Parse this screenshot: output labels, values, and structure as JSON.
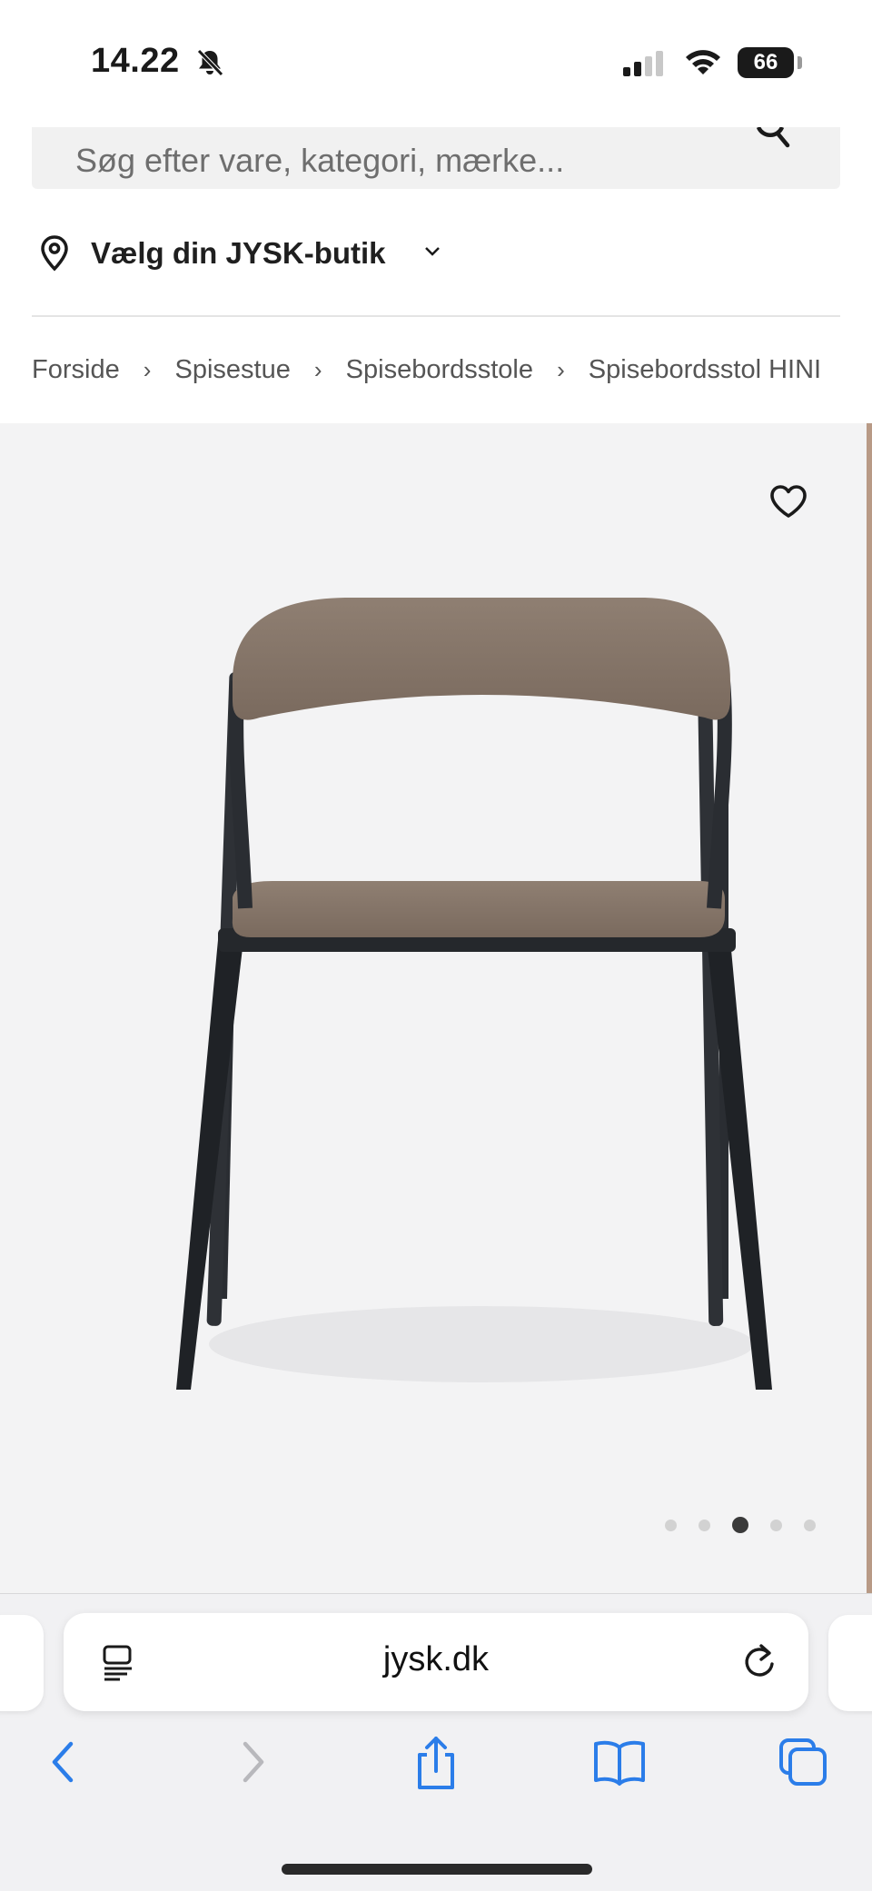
{
  "status": {
    "time": "14.22",
    "battery": "66"
  },
  "search": {
    "placeholder": "Søg efter vare, kategori, mærke..."
  },
  "store": {
    "label": "Vælg din JYSK-butik"
  },
  "breadcrumb": [
    {
      "label": "Forside"
    },
    {
      "label": "Spisestue"
    },
    {
      "label": "Spisebordsstole"
    },
    {
      "label": "Spisebordsstol HINI"
    }
  ],
  "gallery": {
    "image_count": 5,
    "active_index": 2
  },
  "browser": {
    "url": "jysk.dk"
  },
  "icons": [
    "bell-slash-icon",
    "signal-icon",
    "wifi-icon",
    "battery-icon",
    "search-icon",
    "location-pin-icon",
    "chevron-down-icon",
    "chevron-right-icon",
    "heart-icon",
    "reader-icon",
    "reload-icon",
    "back-icon",
    "forward-icon",
    "share-icon",
    "bookmarks-icon",
    "tabs-icon"
  ],
  "colors": {
    "accent": "#2b7de9",
    "chair_fabric": "#8a7a6e",
    "chair_frame": "#24272b"
  }
}
